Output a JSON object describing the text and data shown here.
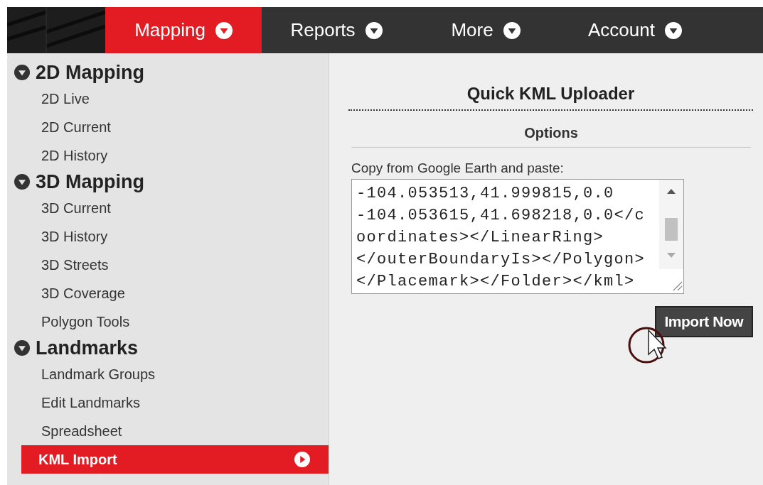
{
  "nav": {
    "tabs": [
      {
        "label": "Mapping",
        "selected": true
      },
      {
        "label": "Reports",
        "selected": false
      },
      {
        "label": "More",
        "selected": false
      },
      {
        "label": "Account",
        "selected": false
      }
    ]
  },
  "sidebar": {
    "groups": [
      {
        "title": "2D Mapping",
        "expanded": true,
        "items": [
          {
            "label": "2D Live",
            "selected": false
          },
          {
            "label": "2D Current",
            "selected": false
          },
          {
            "label": "2D History",
            "selected": false
          }
        ]
      },
      {
        "title": "3D Mapping",
        "expanded": true,
        "items": [
          {
            "label": "3D Current",
            "selected": false
          },
          {
            "label": "3D History",
            "selected": false
          },
          {
            "label": "3D Streets",
            "selected": false
          },
          {
            "label": "3D Coverage",
            "selected": false
          },
          {
            "label": "Polygon Tools",
            "selected": false
          }
        ]
      },
      {
        "title": "Landmarks",
        "expanded": true,
        "items": [
          {
            "label": "Landmark Groups",
            "selected": false
          },
          {
            "label": "Edit Landmarks",
            "selected": false
          },
          {
            "label": "Spreadsheet",
            "selected": false
          },
          {
            "label": "KML Import",
            "selected": true
          }
        ]
      }
    ]
  },
  "panel": {
    "title": "Quick KML Uploader",
    "section": "Options",
    "field_label": "Copy from Google Earth and paste:",
    "field_value": "-104.053513,41.999815,0.0\n-104.053615,41.698218,0.0</c\noordinates></LinearRing>\n</outerBoundaryIs></Polygon>\n</Placemark></Folder></kml>",
    "button": "Import Now"
  }
}
